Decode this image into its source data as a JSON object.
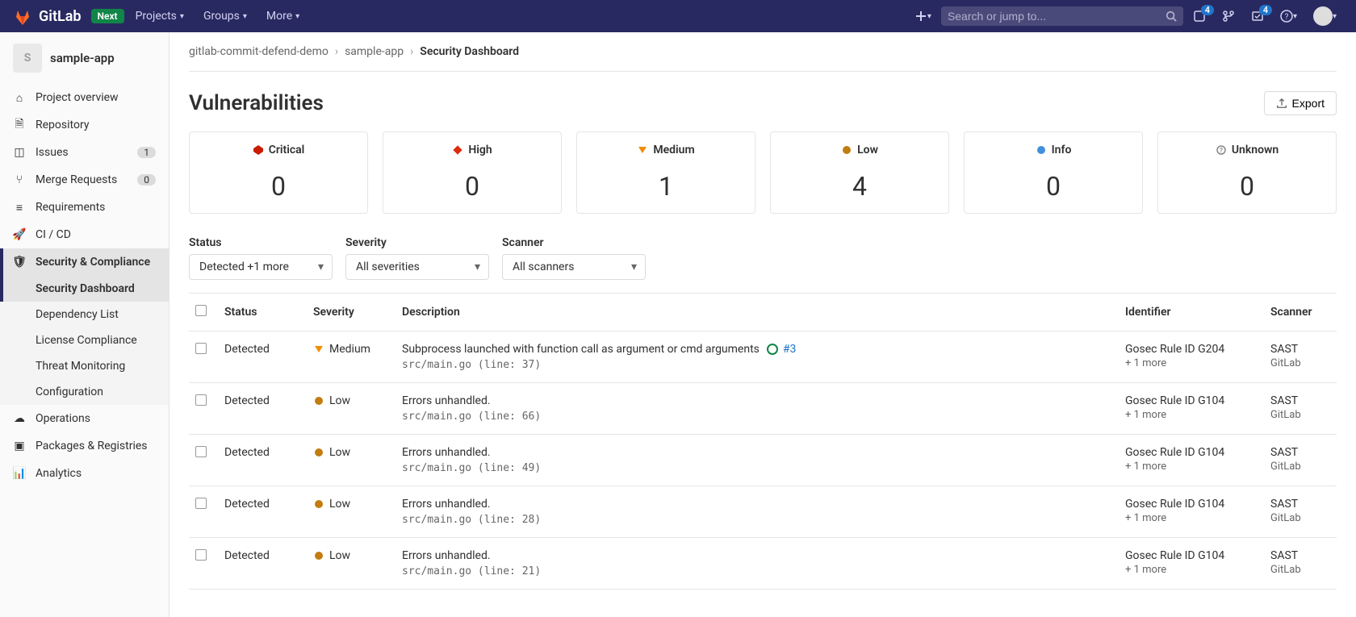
{
  "topbar": {
    "brand": "GitLab",
    "next_badge": "Next",
    "nav": {
      "projects": "Projects",
      "groups": "Groups",
      "more": "More"
    },
    "search_placeholder": "Search or jump to...",
    "issues_badge": "4",
    "todos_badge": "4"
  },
  "project": {
    "initial": "S",
    "name": "sample-app"
  },
  "sidebar": {
    "overview": "Project overview",
    "repository": "Repository",
    "issues": "Issues",
    "issues_count": "1",
    "merge": "Merge Requests",
    "merge_count": "0",
    "requirements": "Requirements",
    "cicd": "CI / CD",
    "security": "Security & Compliance",
    "sub": {
      "dashboard": "Security Dashboard",
      "dependency": "Dependency List",
      "license": "License Compliance",
      "threat": "Threat Monitoring",
      "config": "Configuration"
    },
    "operations": "Operations",
    "packages": "Packages & Registries",
    "analytics": "Analytics"
  },
  "breadcrumb": {
    "b1": "gitlab-commit-defend-demo",
    "b2": "sample-app",
    "b3": "Security Dashboard"
  },
  "page_title": "Vulnerabilities",
  "export_label": "Export",
  "stats": {
    "critical": {
      "label": "Critical",
      "value": "0"
    },
    "high": {
      "label": "High",
      "value": "0"
    },
    "medium": {
      "label": "Medium",
      "value": "1"
    },
    "low": {
      "label": "Low",
      "value": "4"
    },
    "info": {
      "label": "Info",
      "value": "0"
    },
    "unknown": {
      "label": "Unknown",
      "value": "0"
    }
  },
  "filters": {
    "status_label": "Status",
    "status_value": "Detected +1 more",
    "severity_label": "Severity",
    "severity_value": "All severities",
    "scanner_label": "Scanner",
    "scanner_value": "All scanners"
  },
  "table": {
    "h_status": "Status",
    "h_severity": "Severity",
    "h_desc": "Description",
    "h_id": "Identifier",
    "h_scanner": "Scanner",
    "more": "+ 1 more",
    "rows": [
      {
        "status": "Detected",
        "severity": "Medium",
        "desc": "Subprocess launched with function call as argument or cmd arguments",
        "issue": "#3",
        "loc": "src/main.go (line: 37)",
        "ident": "Gosec Rule ID G204",
        "scanner1": "SAST",
        "scanner2": "GitLab"
      },
      {
        "status": "Detected",
        "severity": "Low",
        "desc": "Errors unhandled.",
        "loc": "src/main.go (line: 66)",
        "ident": "Gosec Rule ID G104",
        "scanner1": "SAST",
        "scanner2": "GitLab"
      },
      {
        "status": "Detected",
        "severity": "Low",
        "desc": "Errors unhandled.",
        "loc": "src/main.go (line: 49)",
        "ident": "Gosec Rule ID G104",
        "scanner1": "SAST",
        "scanner2": "GitLab"
      },
      {
        "status": "Detected",
        "severity": "Low",
        "desc": "Errors unhandled.",
        "loc": "src/main.go (line: 28)",
        "ident": "Gosec Rule ID G104",
        "scanner1": "SAST",
        "scanner2": "GitLab"
      },
      {
        "status": "Detected",
        "severity": "Low",
        "desc": "Errors unhandled.",
        "loc": "src/main.go (line: 21)",
        "ident": "Gosec Rule ID G104",
        "scanner1": "SAST",
        "scanner2": "GitLab"
      }
    ]
  }
}
